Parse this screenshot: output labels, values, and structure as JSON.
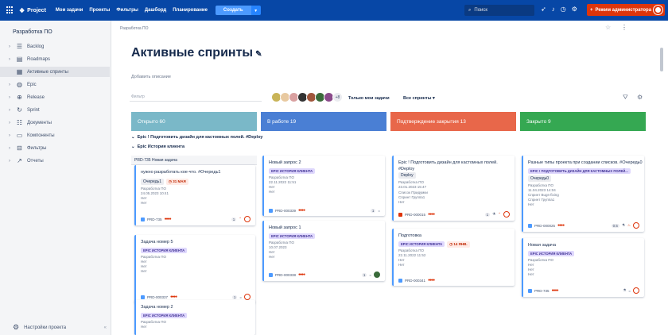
{
  "topnav": {
    "logo_mark": "❖",
    "logo_text": "Project",
    "links": [
      "Мои задачи",
      "Проекты",
      "Фильтры",
      "Дашборд",
      "Планирование"
    ],
    "create_label": "Создать",
    "search_placeholder": "Поиск",
    "admin_label": "Режим администратора",
    "colors": {
      "bar": "#0747a6",
      "admin": "#de350b"
    }
  },
  "sidebar": {
    "project": "Разработка ПО",
    "items": [
      {
        "label": "Backlog",
        "icon": "backlog-icon",
        "chevron": true
      },
      {
        "label": "Roadmaps",
        "icon": "roadmap-icon",
        "chevron": true
      },
      {
        "label": "Активные спринты",
        "icon": "board-icon",
        "chevron": false,
        "active": true
      },
      {
        "label": "Epic",
        "icon": "epic-icon",
        "chevron": true
      },
      {
        "label": "Release",
        "icon": "release-icon",
        "chevron": true
      },
      {
        "label": "Sprint",
        "icon": "sprint-icon",
        "chevron": true
      },
      {
        "label": "Документы",
        "icon": "document-icon",
        "chevron": true
      },
      {
        "label": "Компоненты",
        "icon": "component-icon",
        "chevron": true
      },
      {
        "label": "Фильтры",
        "icon": "filter-icon",
        "chevron": true
      },
      {
        "label": "Отчеты",
        "icon": "report-icon",
        "chevron": true
      }
    ],
    "settings_label": "Настройки проекта"
  },
  "main": {
    "breadcrumb": "Разработка ПО",
    "title": "Активные спринты",
    "description_placeholder": "Добавить описание",
    "filter_placeholder": "Фильтр",
    "avatar_count": "+8",
    "only_mine": "Только мои задачи",
    "all_sprints": "Все спринты"
  },
  "columns": [
    {
      "label": "Открыто 60",
      "color": "#7ab8c8"
    },
    {
      "label": "В работе 19",
      "color": "#4a7fd4"
    },
    {
      "label": "Подтверждение закрытия 13",
      "color": "#e8674a"
    },
    {
      "label": "Закрыто 9",
      "color": "#35a852"
    }
  ],
  "epics": [
    {
      "label": "Epic ! Подготовить дизайн для кастомных полей. #Deploy"
    },
    {
      "label": "Epic История клиента"
    }
  ],
  "new_card": {
    "label": "PRD-735 Новая задача"
  },
  "cards": {
    "c1": {
      "title": "нужно разработать кое-что. #Очередь1",
      "chip": "Очередь1",
      "due": "31 МАЯ",
      "meta": [
        "Разработка ПО",
        "24.05.2023 10:41",
        "Нет",
        "Нет"
      ],
      "key": "PRD-735",
      "priority": "●●●●",
      "count": "1"
    },
    "c2": {
      "title": "Задача номер 5",
      "label": "EPIC ИСТОРИЯ КЛИЕНТА",
      "meta": [
        "Разработка ПО",
        "Нет",
        "Нет",
        "Нет"
      ],
      "key": "PRD-000337",
      "priority": "●●●●",
      "count": "1"
    },
    "c3": {
      "title": "Задача номер 2",
      "label": "EPIC ИСТОРИЯ КЛИЕНТА",
      "meta": [
        "Разработка ПО",
        "Нет"
      ]
    },
    "c4": {
      "title": "Новый запрос 2",
      "label": "EPIC ИСТОРИЯ КЛИЕНТА",
      "meta": [
        "Разработка ПО",
        "22.11.2022 11:51",
        "Нет",
        "Нет"
      ],
      "key": "PRD-000339",
      "priority": "●●●●",
      "count": "1"
    },
    "c5": {
      "title": "Новый запрос 1",
      "label": "EPIC ИСТОРИЯ КЛИЕНТА",
      "meta": [
        "Разработка ПО",
        "10.07.2023",
        "Нет",
        "Нет"
      ],
      "key": "PRD-000338",
      "priority": "●●●●",
      "count": "1"
    },
    "c6": {
      "title": "Epic ! Подготовить дизайн для кастомных полей. #Deploy",
      "chip": "Deploy",
      "meta": [
        "Разработка ПО",
        "23.01.2023 15:47",
        "Список Придумки",
        "Спринт Группа1",
        "Нет"
      ],
      "key": "PRD-000015",
      "priority": "●●●●",
      "count": "1"
    },
    "c7": {
      "title": "Подготовка",
      "label": "EPIC ИСТОРИЯ КЛИЕНТА",
      "due": "14 ЯНВ.",
      "meta": [
        "Разработка ПО",
        "22.11.2022 11:52",
        "Нет",
        "Нет"
      ],
      "key": "PRD-000341",
      "priority": "●●●●"
    },
    "c8": {
      "title": "Разные типы проекта при создании списков. #Очередь0",
      "label": "EPIC ! ПОДГОТОВИТЬ ДИЗАЙН ДЛЯ КАСТОМНЫХ ПОЛЕЙ...",
      "chip": "Очередь0",
      "meta": [
        "Разработка ПО",
        "11.04.2023 14:04",
        "Спринт Bugs-fixing",
        "Спринт Группа1",
        "Нет"
      ],
      "key": "PRD-000025",
      "priority": "●●●●",
      "count": "0.5"
    },
    "c9": {
      "title": "Новая задача",
      "label": "EPIC ИСТОРИЯ КЛИЕНТА",
      "meta": [
        "Разработка ПО",
        "Нет",
        "Нет",
        "Нет"
      ],
      "key": "PRD-735",
      "priority": "●●●●"
    }
  }
}
